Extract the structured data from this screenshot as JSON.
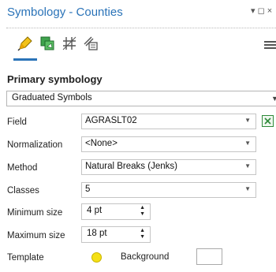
{
  "pane": {
    "title": "Symbology - Counties",
    "title_controls": "▾ ◻ ×"
  },
  "tabs": [
    {
      "name": "primary-symbology",
      "icon": "primary-symbology-icon",
      "active": true
    },
    {
      "name": "symbol-layers",
      "icon": "symbol-layers-icon",
      "active": false
    },
    {
      "name": "vary-symbology",
      "icon": "vary-symbology-icon",
      "active": false
    },
    {
      "name": "advanced-symbology",
      "icon": "advanced-symbology-icon",
      "active": false
    }
  ],
  "section": {
    "title": "Primary symbology",
    "renderer": "Graduated Symbols"
  },
  "form": {
    "field": {
      "label": "Field",
      "value": "AGRASLT02"
    },
    "normalization": {
      "label": "Normalization",
      "value": "<None>"
    },
    "method": {
      "label": "Method",
      "value": "Natural Breaks (Jenks)"
    },
    "classes": {
      "label": "Classes",
      "value": "5"
    },
    "min_size": {
      "label": "Minimum size",
      "value": "4 pt"
    },
    "max_size": {
      "label": "Maximum size",
      "value": "18 pt"
    },
    "template": {
      "label": "Template",
      "background_label": "Background"
    }
  },
  "colors": {
    "accent": "#2a73b8",
    "template_symbol": "#f5e016",
    "expression_button": "#2f8a3a"
  }
}
